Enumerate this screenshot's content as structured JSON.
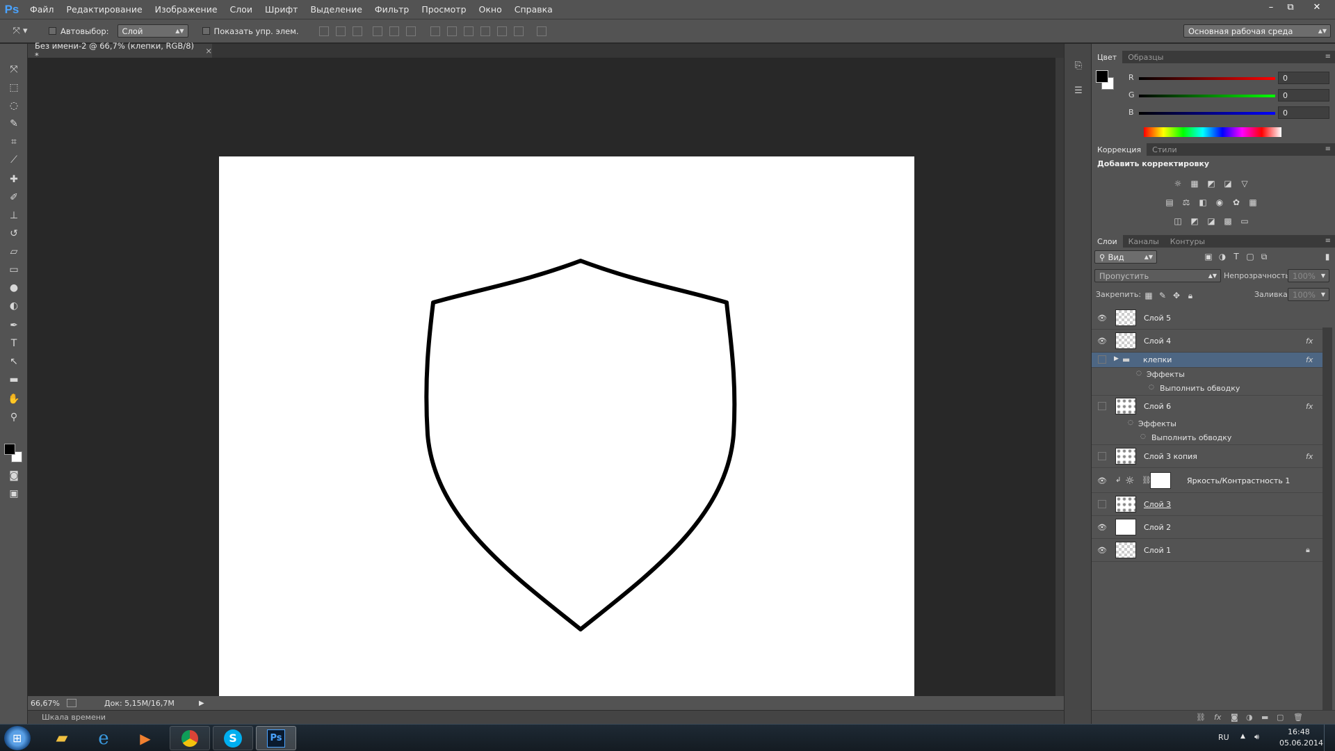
{
  "app": {
    "logo": "Ps"
  },
  "menu": [
    "Файл",
    "Редактирование",
    "Изображение",
    "Слои",
    "Шрифт",
    "Выделение",
    "Фильтр",
    "Просмотр",
    "Окно",
    "Справка"
  ],
  "window_controls": {
    "minimize": "–",
    "restore": "⧉",
    "close": "✕"
  },
  "options": {
    "autoselect_label": "Автовыбор:",
    "autoselect_value": "Слой",
    "show_transform_label": "Показать упр. элем.",
    "workspace": "Основная рабочая среда"
  },
  "document": {
    "tab_title": "Без имени-2 @ 66,7% (клепки, RGB/8) *",
    "close": "×"
  },
  "status": {
    "zoom": "66,67%",
    "doc_size": "Док: 5,15M/16,7M",
    "timeline": "Шкала времени"
  },
  "color_panel": {
    "tabs": [
      "Цвет",
      "Образцы"
    ],
    "r_label": "R",
    "g_label": "G",
    "b_label": "B",
    "r": "0",
    "g": "0",
    "b": "0",
    "foreground": "#000000",
    "background": "#ffffff"
  },
  "adjustments_panel": {
    "tabs": [
      "Коррекция",
      "Стили"
    ],
    "heading": "Добавить корректировку"
  },
  "layers_panel": {
    "tabs": [
      "Слои",
      "Каналы",
      "Контуры"
    ],
    "filter_kind": "Вид",
    "blend_mode": "Пропустить",
    "opacity_label": "Непрозрачность:",
    "opacity_value": "100%",
    "lock_label": "Закрепить:",
    "fill_label": "Заливка:",
    "fill_value": "100%",
    "fx": "fx",
    "layers": {
      "l5": "Слой 5",
      "l4": "Слой 4",
      "group": "клепки",
      "group_effects": "Эффекты",
      "group_stroke": "Выполнить обводку",
      "l6": "Слой 6",
      "l6_effects": "Эффекты",
      "l6_stroke": "Выполнить обводку",
      "l3copy": "Слой 3 копия",
      "bc": "Яркость/Контрастность 1",
      "l3": "Слой 3",
      "l2": "Слой 2",
      "l1": "Слой 1"
    }
  },
  "taskbar": {
    "lang": "RU",
    "time": "16:48",
    "date": "05.06.2014",
    "ps_label": "Ps",
    "skype_label": "S"
  }
}
